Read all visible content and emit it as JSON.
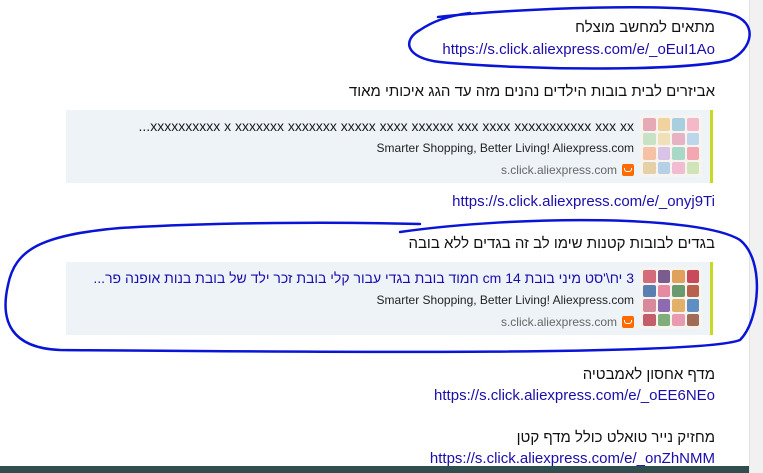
{
  "colors": {
    "link": "#1a0dab",
    "preview_bg": "#eef3f8",
    "preview_accent": "#c9d821",
    "annotation": "#0a14d6",
    "bottom_bar": "#2f4f4f"
  },
  "messages": [
    {
      "text": "מתאים למחשב מוצלח",
      "link": "https://s.click.aliexpress.com/e/_oEuI1Ao"
    },
    {
      "text": "אביזרים לבית בובות הילדים נהנים מזה עד הגג איכותי מאוד",
      "preview": {
        "title": "xxxxxxxxxx x xxxxxxx xxxxxxx xxxxx xxxx xxxxxx xxx xxxx xxxxxxxxxxx xxx xx...",
        "description": "Smarter Shopping, Better Living! Aliexpress.com",
        "site": "s.click.aliexpress.com",
        "icon": "aliexpress-icon"
      },
      "link": "https://s.click.aliexpress.com/e/_onyj9Ti"
    },
    {
      "text": "בגדים לבובות קטנות שימו לב זה בגדים ללא בובה",
      "preview": {
        "title": "3 יח\\'סט מיני בובת 14 cm חמוד בובת בגדי עבור קלי בובת זכר ילד של בובת בנות אופנה פר...",
        "description": "Smarter Shopping, Better Living! Aliexpress.com",
        "site": "s.click.aliexpress.com",
        "icon": "aliexpress-icon"
      }
    },
    {
      "text": "מדף אחסון לאמבטיה",
      "link": "https://s.click.aliexpress.com/e/_oEE6NEo"
    },
    {
      "text": "מחזיק נייר טואלט כולל מדף קטן",
      "link": "https://s.click.aliexpress.com/e/_onZhNMM"
    }
  ]
}
